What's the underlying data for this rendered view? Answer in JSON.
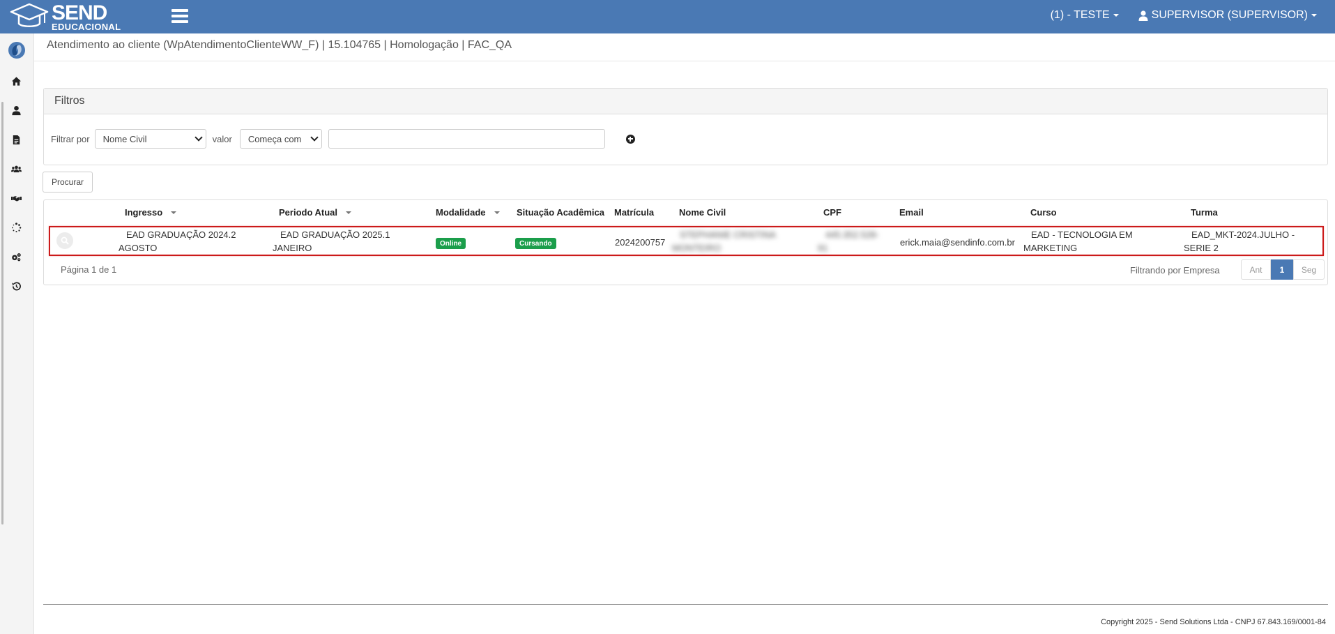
{
  "topbar": {
    "brand_main": "SEND",
    "brand_sub": "EDUCACIONAL",
    "company_menu": "(1) - TESTE",
    "user_menu": "SUPERVISOR (SUPERVISOR)",
    "color": "#4a79b4"
  },
  "sidebar": {
    "icons": [
      "home-icon",
      "user-icon",
      "document-icon",
      "users-icon",
      "handshake-icon",
      "spinner-icon",
      "gears-icon",
      "history-icon"
    ]
  },
  "breadcrumb": "Atendimento ao cliente (WpAtendimentoClienteWW_F) | 15.104765 | Homologação | FAC_QA",
  "filters": {
    "title": "Filtros",
    "filter_by_label": "Filtrar por",
    "filter_by_value": "Nome Civil",
    "value_label": "valor",
    "operator_value": "Começa com",
    "text_value": ""
  },
  "search_button": "Procurar",
  "grid": {
    "columns": [
      "Ingresso",
      "Periodo Atual",
      "Modalidade",
      "Situação Acadêmica",
      "Matrícula",
      "Nome Civil",
      "CPF",
      "Email",
      "Curso",
      "Turma"
    ],
    "row": {
      "ingresso_1": "EAD GRADUAÇÃO 2024.2",
      "ingresso_2": "AGOSTO",
      "periodo_1": "EAD GRADUAÇÃO 2025.1",
      "periodo_2": "JANEIRO",
      "modalidade": "Online",
      "situacao": "Cursando",
      "matricula": "2024200757",
      "nome_1": "STEPHANIE CRISTINA",
      "nome_2": "MONTEIRO",
      "cpf_1": "445.352.528-",
      "cpf_2": "91",
      "email": "erick.maia@sendinfo.com.br",
      "curso_1": "EAD - TECNOLOGIA EM",
      "curso_2": "MARKETING",
      "turma_1": "EAD_MKT-2024.JULHO -",
      "turma_2": "SERIE 2"
    },
    "page_info": "Página 1 de 1",
    "filter_info": "Filtrando por Empresa",
    "prev_label": "Ant",
    "current_page": "1",
    "next_label": "Seg"
  },
  "footer": "Copyright 2025 - Send Solutions Ltda - CNPJ 67.843.169/0001-84"
}
